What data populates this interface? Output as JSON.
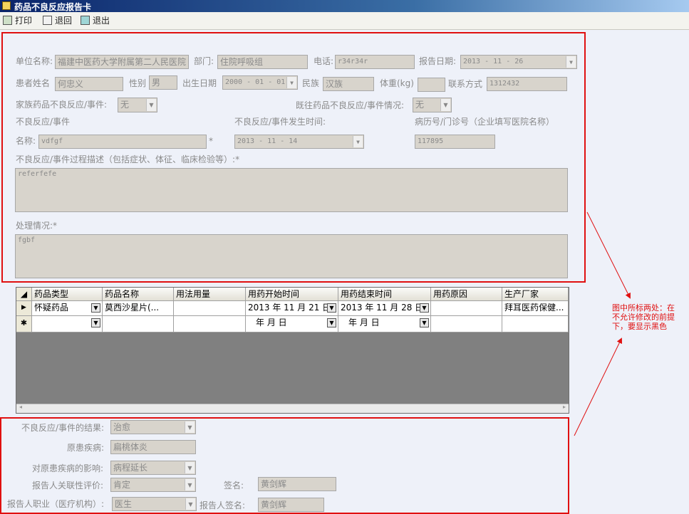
{
  "window": {
    "title": "药品不良反应报告卡"
  },
  "toolbar": {
    "print": "打印",
    "back": "退回",
    "exit": "退出"
  },
  "form": {
    "unit_label": "单位名称:",
    "unit_value": "福建中医药大学附属第二人民医院",
    "dept_label": "部门:",
    "dept_value": "住院呼吸组",
    "phone_label": "电话:",
    "phone_value": "r34r34r",
    "report_date_label": "报告日期:",
    "report_date_value": "2013 - 11 - 26",
    "patient_label": "患者姓名",
    "patient_value": "何忠义",
    "gender_label": "性别",
    "gender_value": "男",
    "birth_label": "出生日期",
    "birth_value": "2000 - 01 - 01",
    "ethnic_label": "民族",
    "ethnic_value": "汉族",
    "weight_label": "体重(kg)",
    "weight_value": "",
    "contact_label": "联系方式",
    "contact_value": "1312432",
    "family_label": "家族药品不良反应/事件:",
    "family_value": "无",
    "history_label": "既往药品不良反应/事件情况:",
    "history_value": "无",
    "adr_label": "不良反应/事件",
    "adr_time_label": "不良反应/事件发生时间:",
    "record_label": "病历号/门诊号（企业填写医院名称）",
    "name_label": "名称:",
    "name_value": "vdfgf",
    "required_mark": "*",
    "adr_time_value": "2013 - 11 - 14",
    "record_value": "117895",
    "desc_label": "不良反应/事件过程描述（包括症状、体征、临床检验等）:*",
    "desc_value": "referfefe",
    "treat_label": "处理情况:*",
    "treat_value": "fgbf"
  },
  "grid": {
    "columns": [
      "药品类型",
      "药品名称",
      "用法用量",
      "用药开始时间",
      "用药结束时间",
      "用药原因",
      "生产厂家"
    ],
    "row1": {
      "marker": "▶",
      "type": "怀疑药品",
      "name": "莫西沙星片(...",
      "usage": "",
      "start": "2013 年 11 月 21 日",
      "end": "2013 年 11 月 28 日",
      "reason": "",
      "maker": "拜耳医药保健..."
    },
    "row2": {
      "marker": "✱",
      "type": "",
      "name": "",
      "usage": "",
      "start": "年   月   日",
      "end": "年   月   日",
      "reason": "",
      "maker": ""
    }
  },
  "result": {
    "outcome_label": "不良反应/事件的结果:",
    "outcome_value": "治愈",
    "disease_label": "原患疾病:",
    "disease_value": "扁桃体炎",
    "impact_label": "对原患疾病的影响:",
    "impact_value": "病程延长",
    "eval_label": "报告人关联性评价:",
    "eval_value": "肯定",
    "sign_label": "签名:",
    "sign_value": "黄剑辉",
    "job_label": "报告人职业（医疗机构）:",
    "job_value": "医生",
    "reporter_sign_label": "报告人签名:",
    "reporter_sign_value": "黄剑辉"
  },
  "annotation": {
    "line1": "图中所标两处：在",
    "line2": "不允许修改的前提",
    "line3": "下，要显示黑色"
  },
  "colors": {
    "highlight": "#e01010",
    "field_bg": "#d8d4cc",
    "page_bg": "#eef1f9"
  }
}
